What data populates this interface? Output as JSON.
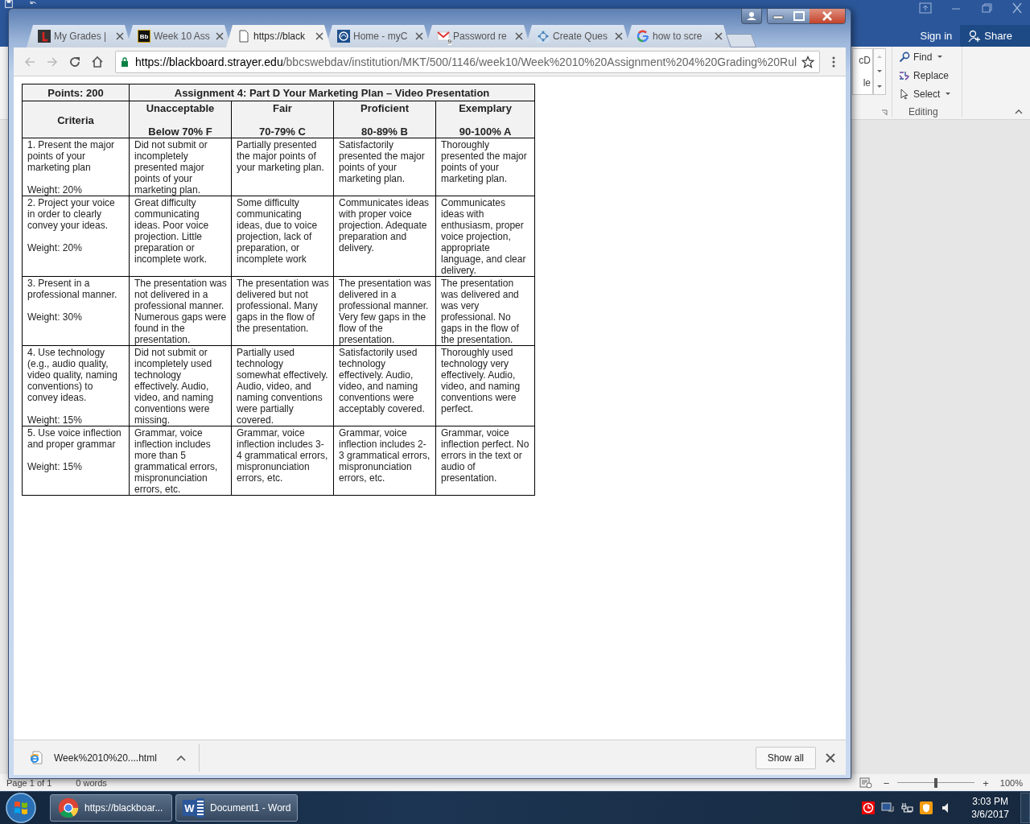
{
  "word": {
    "sign_in": "Sign in",
    "share": "Share",
    "gallery_fragments": [
      "cD",
      "le"
    ],
    "editing": [
      {
        "label": "Find",
        "kind": "find",
        "dropdown": true
      },
      {
        "label": "Replace",
        "kind": "replace",
        "dropdown": false
      },
      {
        "label": "Select",
        "kind": "select",
        "dropdown": true
      }
    ],
    "group_label": "Editing",
    "status": [
      "Page 1 of 1",
      "0 words"
    ],
    "zoom": {
      "label": "100%",
      "level": 0.5,
      "minus": "−",
      "plus": "+"
    }
  },
  "chrome": {
    "tabs": [
      {
        "title": "My Grades |",
        "kind": "grades",
        "selected": false
      },
      {
        "title": "Week 10 Ass",
        "kind": "bb",
        "icon_text": "Bb",
        "selected": false
      },
      {
        "title": "https://black",
        "kind": "page",
        "selected": true
      },
      {
        "title": "Home - myC",
        "kind": "home",
        "selected": false
      },
      {
        "title": "Password re",
        "kind": "mail",
        "icon_text": "9",
        "selected": false
      },
      {
        "title": "Create Ques",
        "kind": "quest",
        "selected": false
      },
      {
        "title": "how to scre",
        "kind": "google",
        "selected": false
      }
    ],
    "url_host": "https://blackboard.strayer.edu",
    "url_path": "/bbcswebdav/institution/MKT/500/1146/week10/Week%2010%20Assignment%204%20Grading%20Rul",
    "rubric": {
      "points": "Points: 200",
      "title": "Assignment 4: Part D Your Marketing Plan – Video Presentation",
      "criteria_heading": "Criteria",
      "levels": [
        {
          "name": "Unacceptable",
          "range": "Below 70% F"
        },
        {
          "name": "Fair",
          "range": "70-79% C"
        },
        {
          "name": "Proficient",
          "range": "80-89% B"
        },
        {
          "name": "Exemplary",
          "range": "90-100% A"
        }
      ],
      "rows": [
        {
          "criterion": "1. Present the major points of your marketing plan",
          "weight": "Weight: 20%",
          "cells": [
            "Did not submit or incompletely presented major points of your marketing plan.",
            "Partially presented the major points of your marketing plan.",
            "Satisfactorily presented the major points of your marketing plan.",
            "Thoroughly presented the major points of your marketing plan."
          ]
        },
        {
          "criterion": "2. Project your voice in order to clearly convey your ideas.",
          "weight": "Weight: 20%",
          "cells": [
            "Great difficulty communicating ideas. Poor voice projection. Little preparation or incomplete work.",
            "Some difficulty communicating ideas, due to voice projection, lack of preparation, or incomplete work",
            "Communicates ideas with proper voice projection. Adequate preparation and delivery.",
            "Communicates ideas with enthusiasm, proper voice projection, appropriate language, and clear delivery."
          ]
        },
        {
          "criterion": "3.  Present in a professional manner.",
          "weight": "Weight: 30%",
          "cells": [
            "The presentation was not delivered in a professional manner. Numerous gaps were found in the presentation.",
            "The presentation was delivered but not professional. Many gaps in the flow of the presentation.",
            "The presentation was delivered in a professional manner. Very few gaps in the flow of the presentation.",
            "The presentation was delivered and was very professional. No gaps in the flow of the presentation."
          ]
        },
        {
          "criterion": "4. Use technology (e.g., audio quality, video quality, naming conventions) to convey ideas.",
          "weight": "Weight: 15%",
          "cells": [
            "Did not submit or incompletely used technology effectively. Audio, video, and naming conventions were missing.",
            "Partially used technology somewhat effectively. Audio, video, and naming conventions were partially covered.",
            "Satisfactorily used technology effectively. Audio, video, and naming conventions were acceptably covered.",
            "Thoroughly used technology very effectively. Audio, video, and naming conventions were perfect."
          ]
        },
        {
          "criterion": "5. Use voice inflection and proper grammar",
          "weight": "Weight: 15%",
          "cells": [
            "Grammar, voice inflection includes more than 5 grammatical errors, mispronunciation errors, etc.",
            "Grammar, voice inflection includes 3-4 grammatical errors, mispronunciation errors, etc.",
            "Grammar, voice inflection includes 2-3 grammatical errors, mispronunciation errors, etc.",
            "Grammar, voice inflection perfect. No errors in the text or audio of presentation."
          ]
        }
      ]
    },
    "download": {
      "filename": "Week%2010%20....html",
      "show_all": "Show all"
    }
  },
  "taskbar": {
    "items": [
      {
        "label": "https://blackboar...",
        "kind": "chrome"
      },
      {
        "label": "Document1 - Word",
        "kind": "word",
        "icon_text": "W"
      }
    ],
    "time": "3:03 PM",
    "date": "3/6/2017"
  }
}
